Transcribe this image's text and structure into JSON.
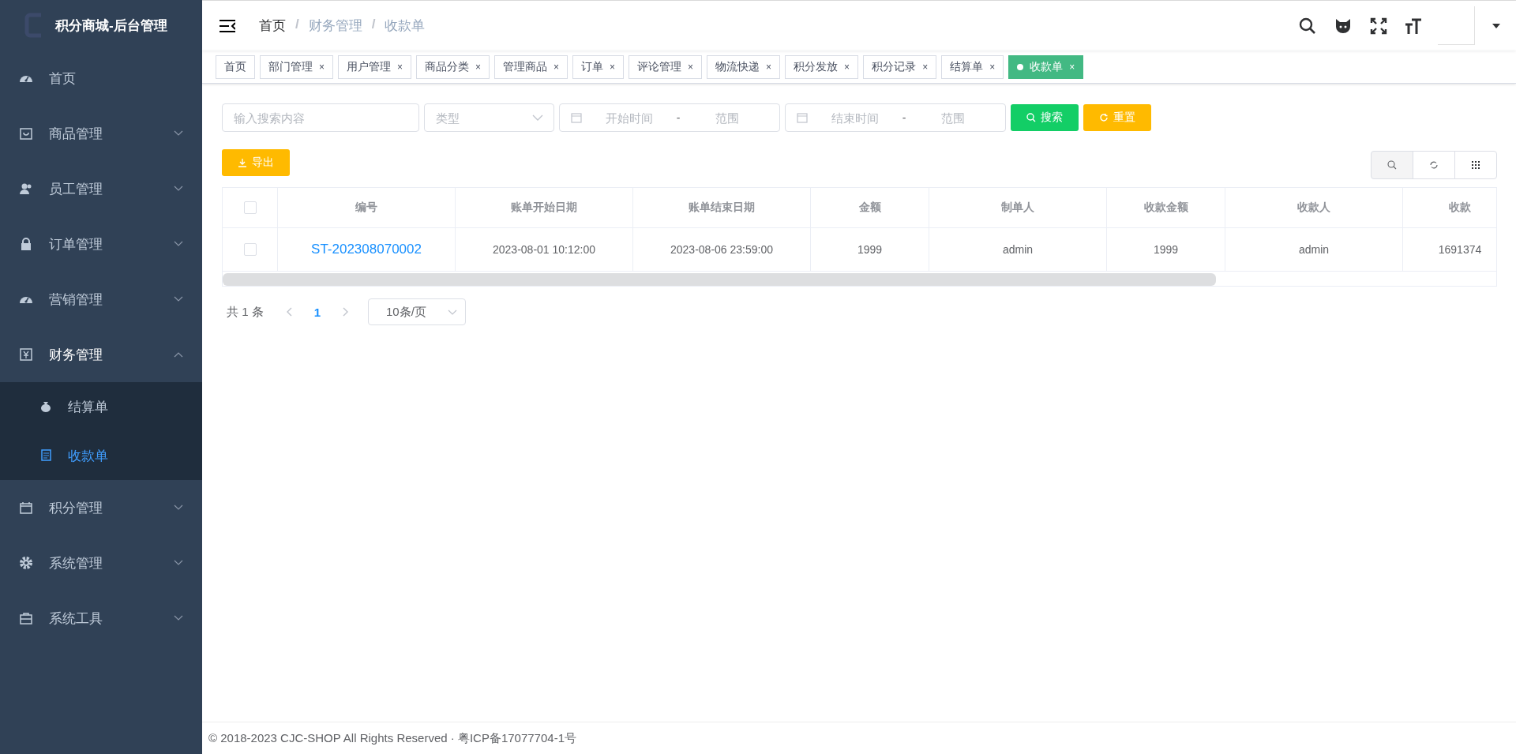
{
  "logo": {
    "title": "积分商城-后台管理"
  },
  "sidebar": {
    "items": [
      {
        "label": "首页",
        "has_children": false,
        "expanded": false
      },
      {
        "label": "商品管理",
        "has_children": true,
        "expanded": false
      },
      {
        "label": "员工管理",
        "has_children": true,
        "expanded": false
      },
      {
        "label": "订单管理",
        "has_children": true,
        "expanded": false
      },
      {
        "label": "营销管理",
        "has_children": true,
        "expanded": false
      },
      {
        "label": "财务管理",
        "has_children": true,
        "expanded": true,
        "children": [
          {
            "label": "结算单",
            "selected": false
          },
          {
            "label": "收款单",
            "selected": true
          }
        ]
      },
      {
        "label": "积分管理",
        "has_children": true,
        "expanded": false
      },
      {
        "label": "系统管理",
        "has_children": true,
        "expanded": false
      },
      {
        "label": "系统工具",
        "has_children": true,
        "expanded": false
      }
    ]
  },
  "breadcrumb": [
    "首页",
    "财务管理",
    "收款单"
  ],
  "breadcrumb_separator": "/",
  "tags": [
    {
      "label": "首页",
      "closable": false,
      "selected": false
    },
    {
      "label": "部门管理",
      "closable": true,
      "selected": false
    },
    {
      "label": "用户管理",
      "closable": true,
      "selected": false
    },
    {
      "label": "商品分类",
      "closable": true,
      "selected": false
    },
    {
      "label": "管理商品",
      "closable": true,
      "selected": false
    },
    {
      "label": "订单",
      "closable": true,
      "selected": false
    },
    {
      "label": "评论管理",
      "closable": true,
      "selected": false
    },
    {
      "label": "物流快递",
      "closable": true,
      "selected": false
    },
    {
      "label": "积分发放",
      "closable": true,
      "selected": false
    },
    {
      "label": "积分记录",
      "closable": true,
      "selected": false
    },
    {
      "label": "结算单",
      "closable": true,
      "selected": false
    },
    {
      "label": "收款单",
      "closable": true,
      "selected": true
    }
  ],
  "tag_close": "×",
  "filters": {
    "search": {
      "placeholder": "输入搜索内容"
    },
    "type": {
      "placeholder": "类型"
    },
    "start": {
      "placeholder": "开始时间",
      "separator": "-",
      "end_placeholder": "范围"
    },
    "end": {
      "placeholder": "结束时间",
      "separator": "-",
      "end_placeholder": "范围"
    },
    "search_button": "搜索",
    "reset_button": "重置"
  },
  "export_button": "导出",
  "table": {
    "columns": [
      "编号",
      "账单开始日期",
      "账单结束日期",
      "金额",
      "制单人",
      "收款金额",
      "收款人",
      "收款"
    ],
    "rows": [
      {
        "checked": false,
        "cells": [
          "ST-202308070002",
          "2023-08-01 10:12:00",
          "2023-08-06 23:59:00",
          "1999",
          "admin",
          "1999",
          "admin",
          "1691374"
        ]
      }
    ],
    "header_checked": false
  },
  "pagination": {
    "total": "共 1 条",
    "pages": [
      {
        "label": "1",
        "selected": true
      }
    ],
    "page_size": "10条/页"
  },
  "footer": "© 2018-2023 CJC-SHOP All Rights Reserved · 粤ICP备17077704-1号"
}
